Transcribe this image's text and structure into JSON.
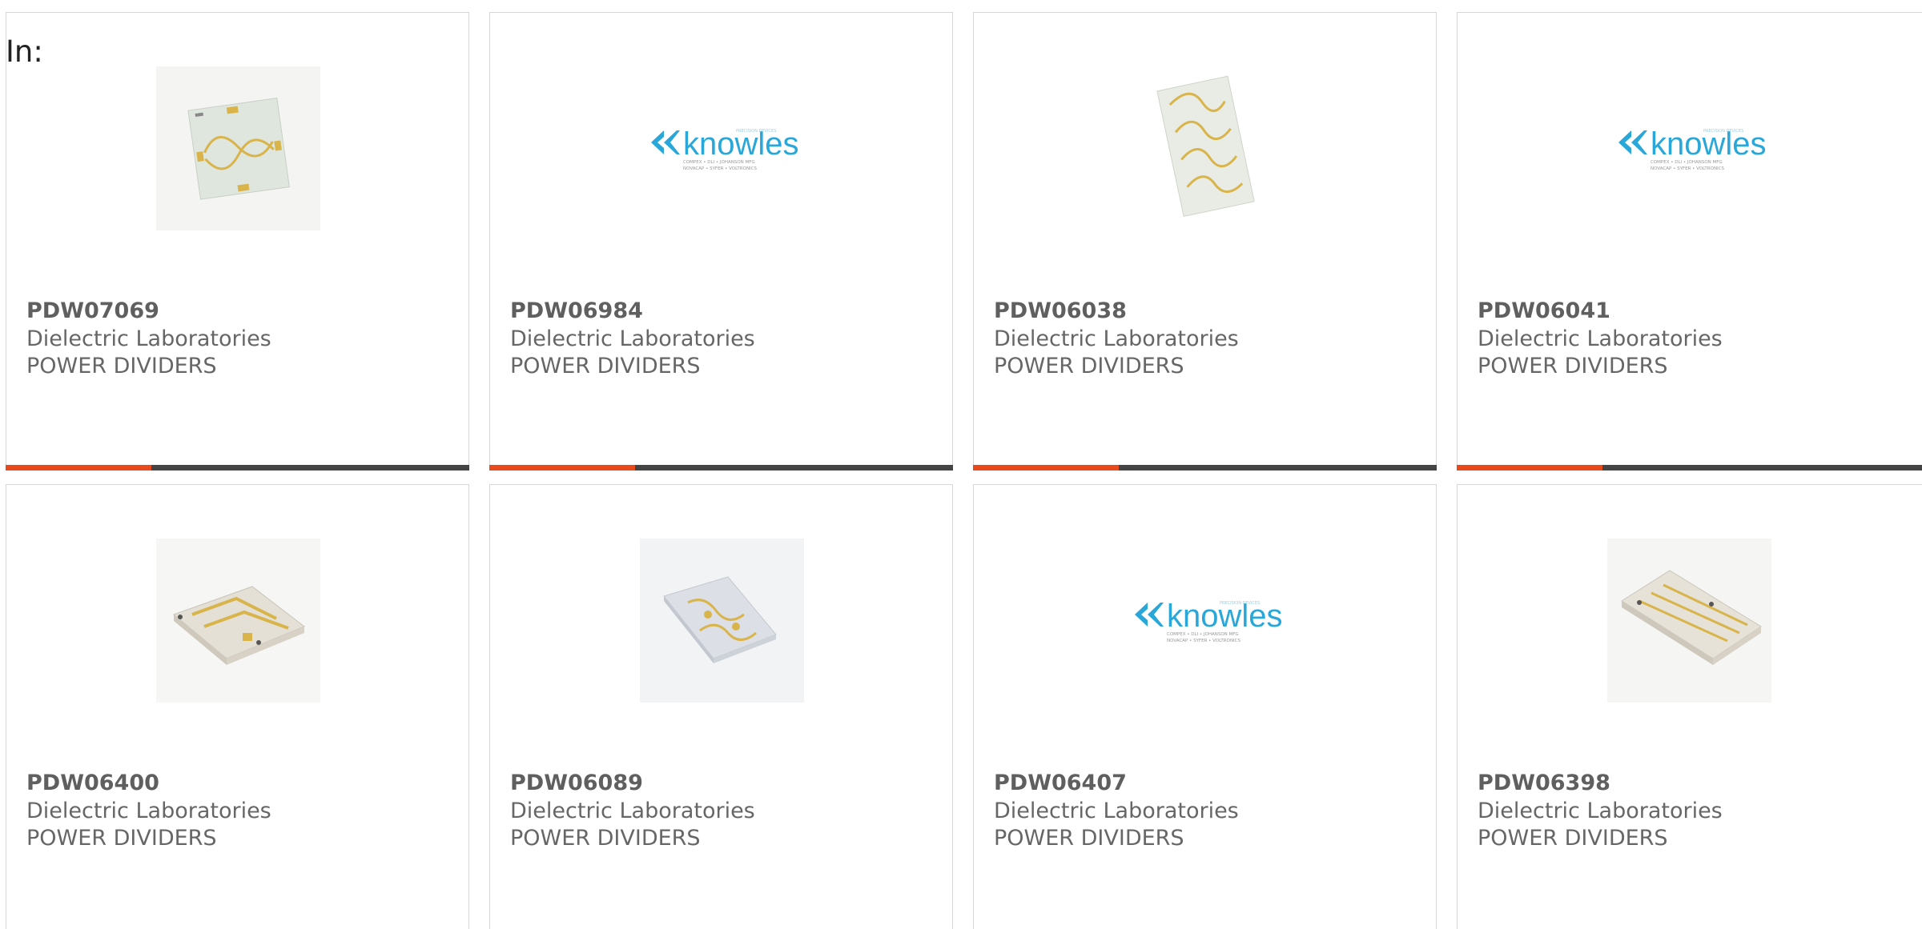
{
  "filter": {
    "label": "In:"
  },
  "colors": {
    "accent": "#e84a1b",
    "bar": "#444444",
    "knowles_blue": "#2aa7d9"
  },
  "products": [
    {
      "part": "PDW07069",
      "manufacturer": "Dielectric Laboratories",
      "category": "POWER DIVIDERS",
      "image": "chip-meander"
    },
    {
      "part": "PDW06984",
      "manufacturer": "Dielectric Laboratories",
      "category": "POWER DIVIDERS",
      "image": "knowles-logo"
    },
    {
      "part": "PDW06038",
      "manufacturer": "Dielectric Laboratories",
      "category": "POWER DIVIDERS",
      "image": "chip-long-meander"
    },
    {
      "part": "PDW06041",
      "manufacturer": "Dielectric Laboratories",
      "category": "POWER DIVIDERS",
      "image": "knowles-logo"
    },
    {
      "part": "PDW06400",
      "manufacturer": "Dielectric Laboratories",
      "category": "POWER DIVIDERS",
      "image": "chip-3d-wide"
    },
    {
      "part": "PDW06089",
      "manufacturer": "Dielectric Laboratories",
      "category": "POWER DIVIDERS",
      "image": "chip-3d-tilted"
    },
    {
      "part": "PDW06407",
      "manufacturer": "Dielectric Laboratories",
      "category": "POWER DIVIDERS",
      "image": "knowles-logo"
    },
    {
      "part": "PDW06398",
      "manufacturer": "Dielectric Laboratories",
      "category": "POWER DIVIDERS",
      "image": "chip-3d-lines"
    }
  ],
  "logo": {
    "wordmark": "knowles",
    "tagline": "PRECISION DEVICES",
    "brands_line1": "COMPEX • DLI • JOHANSON MFG",
    "brands_line2": "NOVACAP • SYFER • VOLTRONICS"
  }
}
